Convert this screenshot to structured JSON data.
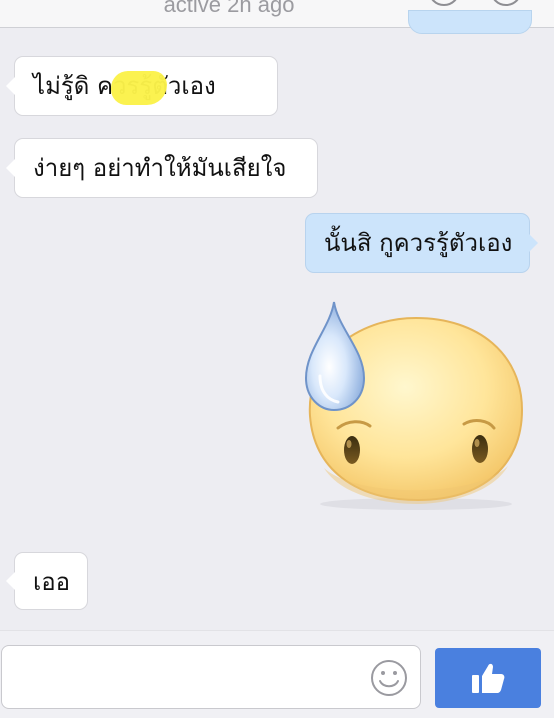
{
  "header": {
    "status_text": "active 2h ago"
  },
  "messages": [
    {
      "direction": "incoming",
      "text": "ไม่รู้ดิ       ควรรู้ตัวเอง",
      "redacted": true
    },
    {
      "direction": "incoming",
      "text": "ง่ายๆ อย่าทำให้มันเสียใจ"
    },
    {
      "direction": "outgoing",
      "text": "นั้นสิ กูควรรู้ตัวเอง"
    },
    {
      "direction": "outgoing",
      "type": "sticker",
      "sticker": "sweat-drop-face-sticker"
    },
    {
      "direction": "incoming",
      "text": "เออ"
    }
  ],
  "composer": {
    "input_value": "",
    "input_placeholder": "",
    "emoji_icon": "smiley-icon",
    "send_icon": "thumbs-up-icon"
  },
  "colors": {
    "background": "#ededf2",
    "incoming_bubble": "#ffffff",
    "outgoing_bubble": "#cce4fb",
    "like_button": "#4a80df",
    "redaction": "#fbf24a"
  }
}
